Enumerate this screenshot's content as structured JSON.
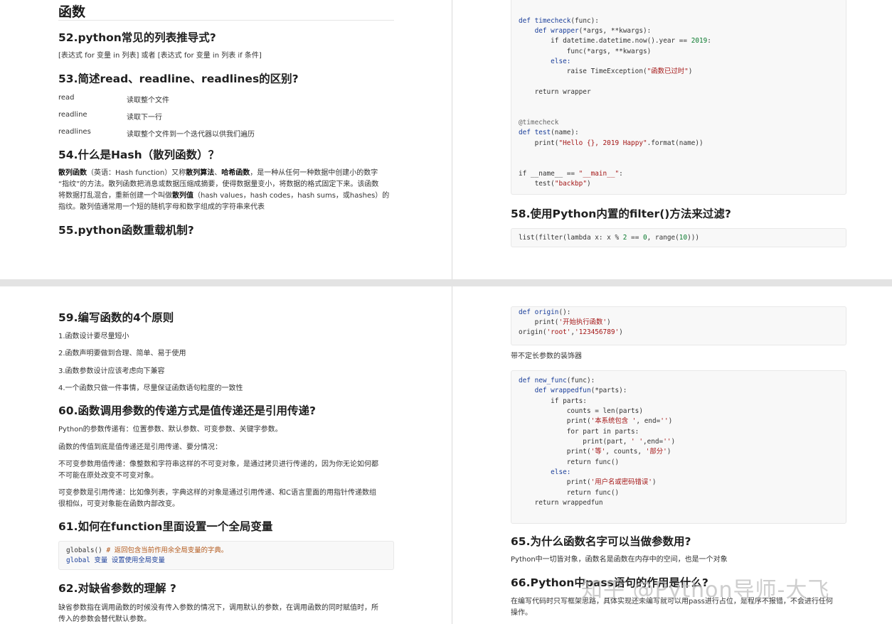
{
  "q1": {
    "section_title": "函数",
    "q52": {
      "title": "52.python常见的列表推导式?",
      "text": "[表达式 for 变量 in 列表] 或者 [表达式 for 变量 in 列表 if 条件]"
    },
    "q53": {
      "title": "53.简述read、readline、readlines的区别?",
      "rows": [
        {
          "term": "read",
          "desc": "读取整个文件"
        },
        {
          "term": "readline",
          "desc": "读取下一行"
        },
        {
          "term": "readlines",
          "desc": "读取整个文件到一个迭代器以供我们遍历"
        }
      ]
    },
    "q54": {
      "title": "54.什么是Hash（散列函数）？",
      "b1": "散列函数",
      "t1": "（英语：Hash function）又称",
      "b2": "散列算法",
      "t2": "、",
      "b3": "哈希函数",
      "t3": "，是一种从任何一种数据中创建小的数字",
      "line2": "“指纹”的方法。散列函数把消息或数据压缩成摘要，使得数据量变小，将数据的格式固定下来。该函数",
      "t4": "将数据打乱混合，重新创建一个叫做",
      "b4": "散列值",
      "t5": "（hash values，hash codes，hash sums，或hashes）的",
      "line4": "指纹。散列值通常用一个短的随机字母和数字组成的字符串来代表"
    },
    "q55": {
      "title": "55.python函数重载机制?"
    }
  },
  "q2": {
    "code1": {
      "l1a": "def ",
      "l1b": "timecheck",
      "l1c": "(func):",
      "l2a": "    def ",
      "l2b": "wrapper",
      "l2c": "(*args, **kwargs):",
      "l3a": "        if datetime.datetime.now().year == ",
      "l3b": "2019",
      "l3c": ":",
      "l4": "            func(*args, **kwargs)",
      "l5": "        else:",
      "l6a": "            raise TimeException(",
      "l6b": "\"函数已过时\"",
      "l6c": ")",
      "l7": "    return wrapper",
      "l8": "@timecheck",
      "l9a": "def ",
      "l9b": "test",
      "l9c": "(name):",
      "l10a": "    print(",
      "l10b": "\"Hello {}, 2019 Happy\"",
      "l10c": ".format(name))",
      "l11a": "if __name__ == ",
      "l11b": "\"__main__\"",
      "l11c": ":",
      "l12a": "    test(",
      "l12b": "\"backbp\"",
      "l12c": ")"
    },
    "q58": {
      "title": "58.使用Python内置的filter()方法来过滤?"
    },
    "code2": {
      "a": "list(filter(lambda x: x % ",
      "b": "2",
      "c": " == ",
      "d": "0",
      "e": ", range(",
      "f": "10",
      "g": ")))"
    }
  },
  "q3": {
    "q59": {
      "title": "59.编写函数的4个原则",
      "items": [
        "1.函数设计要尽量短小",
        "2.函数声明要做到合理、简单、易于使用",
        "3.函数参数设计应该考虑向下兼容",
        "4.一个函数只做一件事情，尽量保证函数语句粒度的一致性"
      ]
    },
    "q60": {
      "title": "60.函数调用参数的传递方式是值传递还是引用传递?",
      "p1": "Python的参数传递有：位置参数、默认参数、可变参数、关键字参数。",
      "p2": "函数的传值到底是值传递还是引用传递、要分情况：",
      "p3a": "不可变参数用值传递：像整数和字符串这样的不可变对象，是通过拷贝进行传递的，因为你无论如何都",
      "p3b": "不可能在原处改变不可变对象。",
      "p4a": "可变参数是引用传递：比如像列表，字典这样的对象是通过引用传递、和C语言里面的用指针传递数组",
      "p4b": "很相似，可变对象能在函数内部改变。"
    },
    "q61": {
      "title": "61.如何在function里面设置一个全局变量",
      "c1a": "globals() ",
      "c1b": "# 返回包含当前作用余全局变量的字典。",
      "c2": "global 变量 设置使用全局变量"
    },
    "q62": {
      "title": "62.对缺省参数的理解 ?",
      "p1": "缺省参数指在调用函数的时候没有传入参数的情况下，调用默认的参数，在调用函数的同时赋值时，所",
      "p2": "传入的参数会替代默认参数。"
    }
  },
  "q4": {
    "code3": {
      "l1a": "def ",
      "l1b": "origin",
      "l1c": "():",
      "l2a": "    print(",
      "l2b": "'开始执行函数'",
      "l2c": ")",
      "l3a": "origin(",
      "l3b": "'root'",
      "l3c": ",",
      "l3d": "'123456789'",
      "l3e": ")"
    },
    "caption": "带不定长参数的装饰器",
    "code4": {
      "l1a": "def ",
      "l1b": "new_func",
      "l1c": "(func):",
      "l2a": "    def ",
      "l2b": "wrappedfun",
      "l2c": "(*parts):",
      "l3": "        if parts:",
      "l4": "            counts = len(parts)",
      "l5a": "            print(",
      "l5b": "'本系统包含 '",
      "l5c": ", end=",
      "l5d": "''",
      "l5e": ")",
      "l6": "            for part in parts:",
      "l7a": "                print(part, ",
      "l7b": "' '",
      "l7c": ",end=",
      "l7d": "''",
      "l7e": ")",
      "l8a": "            print(",
      "l8b": "'等'",
      "l8c": ", counts, ",
      "l8d": "'部分'",
      "l8e": ")",
      "l9": "            return func()",
      "l10": "        else:",
      "l11a": "            print(",
      "l11b": "'用户名或密码错误'",
      "l11c": ")",
      "l12": "            return func()",
      "l13": "    return wrappedfun"
    },
    "q65": {
      "title": "65.为什么函数名字可以当做参数用?",
      "text": "Python中一切皆对象，函数名是函数在内存中的空间，也是一个对象"
    },
    "q66": {
      "title": "66.Python中pass语句的作用是什么?",
      "p1": "在编写代码时只写框架思路，具体实现还未编写就可以用pass进行占位，是程序不报错，不会进行任何",
      "p2": "操作。"
    },
    "watermark": "知乎 @Python导师-大飞"
  }
}
